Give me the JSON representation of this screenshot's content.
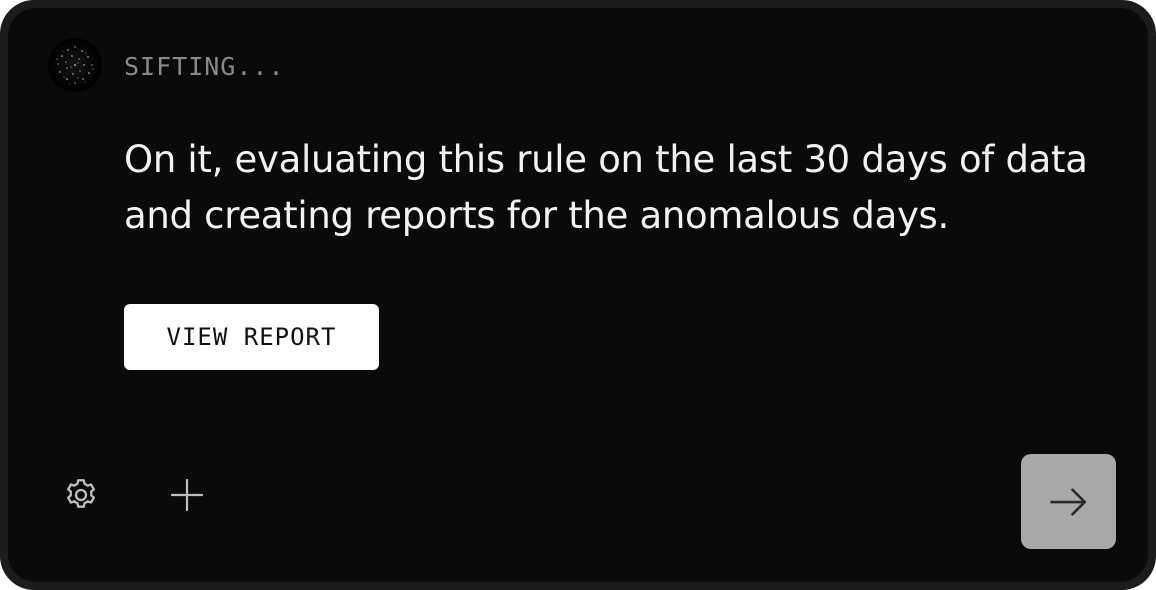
{
  "assistant": {
    "avatar_icon": "starfield-avatar-icon",
    "status": "SIFTING..."
  },
  "message": {
    "text": "On it, evaluating this rule on the last 30 days of data and creating reports for the anomalous days."
  },
  "actions": {
    "view_report_label": "VIEW REPORT"
  },
  "toolbar": {
    "settings_icon": "gear-icon",
    "add_icon": "plus-icon",
    "send_icon": "arrow-right-icon"
  },
  "colors": {
    "frame": "#1c1c1c",
    "card_background": "#0a0a0a",
    "text_primary": "#f2f2f2",
    "text_muted": "#8a8a8a",
    "button_background": "#ffffff",
    "send_button_background": "#a8a8a8"
  }
}
